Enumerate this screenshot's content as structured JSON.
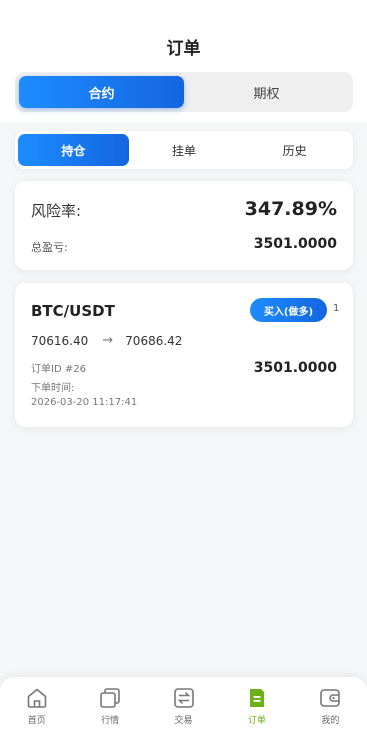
{
  "header": {
    "title": "订单"
  },
  "main_tabs": [
    {
      "label": "合约",
      "active": true
    },
    {
      "label": "期权",
      "active": false
    }
  ],
  "sub_tabs": [
    {
      "label": "持仓",
      "active": true
    },
    {
      "label": "挂单",
      "active": false
    },
    {
      "label": "历史",
      "active": false
    }
  ],
  "summary": {
    "risk_label": "风险率:",
    "risk_value": "347.89%",
    "pnl_label": "总盈亏:",
    "pnl_value": "3501.0000"
  },
  "order": {
    "pair": "BTC/USDT",
    "side_label": "买入(做多)",
    "leverage": "1",
    "open_price": "70616.40",
    "arrow": "→",
    "current_price": "70686.42",
    "order_id": "订单ID #26",
    "time_label": "下单时间:",
    "time": "2026-03-20 11:17:41",
    "amount": "3501.0000"
  },
  "tabbar": [
    {
      "label": "首页",
      "icon": "home-icon"
    },
    {
      "label": "行情",
      "icon": "market-icon"
    },
    {
      "label": "交易",
      "icon": "exchange-icon"
    },
    {
      "label": "订单",
      "icon": "order-icon",
      "active": true
    },
    {
      "label": "我的",
      "icon": "wallet-icon"
    }
  ],
  "colors": {
    "accent": "#1466e0",
    "active_tab": "#6cb216",
    "background": "#f5f6f8"
  }
}
